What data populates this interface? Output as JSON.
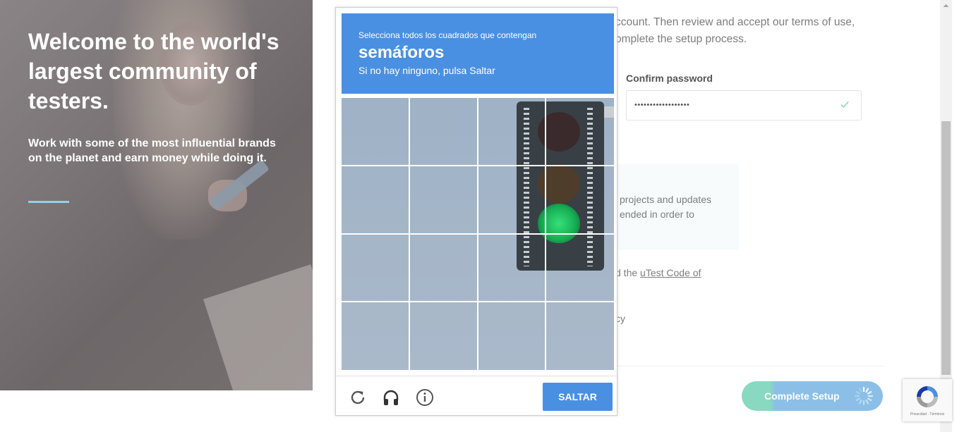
{
  "hero": {
    "title": "Welcome to the world's largest community of testers.",
    "subtitle": "Work with some of the most influential brands on the planet and earn money while doing it."
  },
  "form": {
    "intro_line1": "ccount. Then review and accept our terms of use,",
    "intro_line2": "omplete the setup process.",
    "confirm_password_label": "Confirm password",
    "confirm_password_value": "••••••••••••••••••",
    "info_line1": "projects and updates",
    "info_line2": "ended in order to",
    "code_prefix": "d the ",
    "code_link": "uTest Code of",
    "policy_fragment": "cy",
    "complete_setup_label": "Complete Setup"
  },
  "captcha": {
    "instruction": "Selecciona todos los cuadrados que contengan",
    "target": "semáforos",
    "hint": "Si no hay ninguno, pulsa Saltar",
    "skip_label": "SALTAR",
    "icons": [
      "reload-icon",
      "headphones-icon",
      "info-icon"
    ]
  },
  "recaptcha_badge": {
    "terms": "Privacidad - Términos"
  },
  "colors": {
    "captcha_blue": "#4a90e2",
    "setup_green": "#89d8c0",
    "setup_blue": "#8cbfe7",
    "accent_rule": "#8fd3e3"
  }
}
